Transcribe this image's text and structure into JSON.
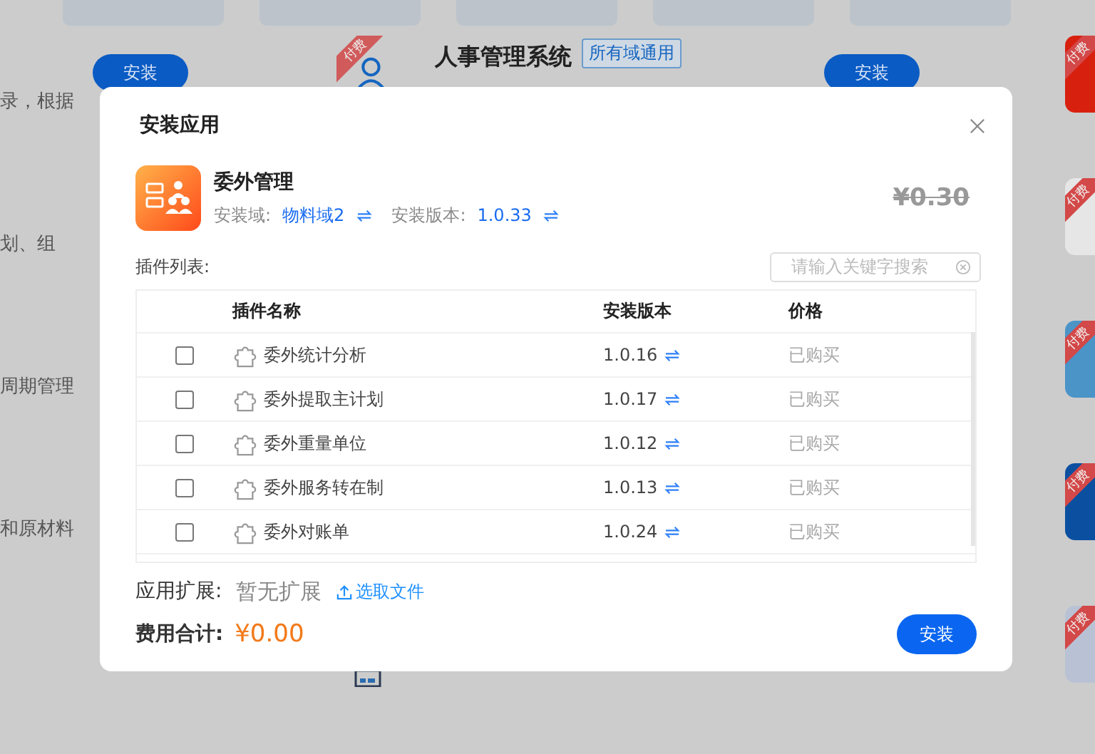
{
  "background": {
    "buttons": [
      "安装",
      "安装"
    ],
    "featured": {
      "badge": "付费",
      "title": "人事管理系统",
      "tag": "所有域通用"
    },
    "side_texts": [
      "录，根据",
      "划、组",
      "周期管理",
      "和原材料"
    ],
    "tiles": [
      {
        "badge": "付费",
        "color": "#d8200f"
      },
      {
        "badge": "付费",
        "color": "#e6e6e6"
      },
      {
        "badge": "付费",
        "color": "#4a94c8"
      },
      {
        "badge": "付费",
        "color": "#0b4fa0"
      },
      {
        "badge": "付费",
        "color": "#b9c2d4"
      }
    ]
  },
  "dialog": {
    "title": "安装应用",
    "app": {
      "name": "委外管理",
      "domain_label": "安装域:",
      "domain": "物料域2",
      "version_label": "安装版本:",
      "version": "1.0.33",
      "price": "¥0.30"
    },
    "plugin_label": "插件列表:",
    "search": {
      "placeholder": "请输入关键字搜索"
    },
    "table": {
      "columns": [
        "插件名称",
        "安装版本",
        "价格"
      ],
      "rows": [
        {
          "checked": false,
          "name": "委外统计分析",
          "version": "1.0.16",
          "price": "已购买"
        },
        {
          "checked": false,
          "name": "委外提取主计划",
          "version": "1.0.17",
          "price": "已购买"
        },
        {
          "checked": false,
          "name": "委外重量单位",
          "version": "1.0.12",
          "price": "已购买"
        },
        {
          "checked": false,
          "name": "委外服务转在制",
          "version": "1.0.13",
          "price": "已购买"
        },
        {
          "checked": false,
          "name": "委外对账单",
          "version": "1.0.24",
          "price": "已购买"
        }
      ]
    },
    "extension": {
      "label": "应用扩展:",
      "value": "暂无扩展",
      "action": "选取文件"
    },
    "total": {
      "label": "费用合计:",
      "value": "¥0.00"
    },
    "install_button": "安装"
  }
}
